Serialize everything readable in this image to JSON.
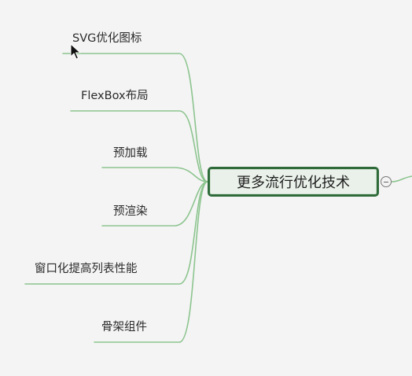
{
  "mindmap": {
    "central_topic": "更多流行优化技术",
    "branches": [
      {
        "label": "SVG优化图标"
      },
      {
        "label": "FlexBox布局"
      },
      {
        "label": "预加载"
      },
      {
        "label": "预渲染"
      },
      {
        "label": "窗口化提高列表性能"
      },
      {
        "label": "骨架组件"
      }
    ]
  },
  "colors": {
    "connector": "#8cc48e",
    "central_border": "#2f6b3a",
    "central_fill": "#eaf1ea",
    "background": "#f4f4f4"
  },
  "icons": {
    "cursor": "mouse-pointer-icon",
    "collapse": "collapse-minus-icon"
  }
}
